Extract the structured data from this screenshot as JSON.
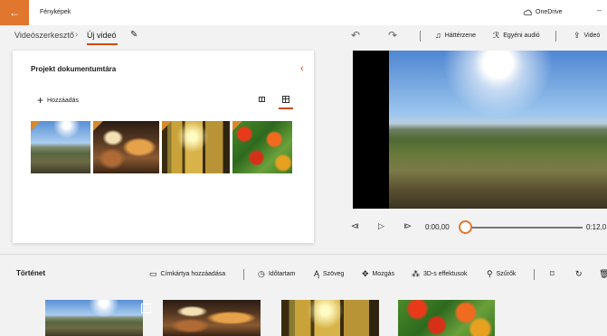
{
  "titlebar": {
    "back_icon": "back-arrow-icon",
    "app_title": "Fényképek",
    "onedrive_label": "OneDrive",
    "minimize_glyph": "–",
    "accent_color": "#e1762f"
  },
  "breadcrumb": {
    "root": "Videószerkesztő",
    "current": "Új videó"
  },
  "toolbar": {
    "background_music": "Háttérzene",
    "custom_audio": "Egyéni audió",
    "export": "Videó"
  },
  "library": {
    "title": "Projekt dokumentumtára",
    "add_label": "Hozzáadás",
    "thumbnails": [
      "landscape",
      "coffee",
      "autumn-forest",
      "autumn-leaves"
    ]
  },
  "player": {
    "current_time": "0:00,00",
    "end_time": "0:12,0",
    "progress": 0
  },
  "storyboard": {
    "title": "Történet",
    "add_title_card": "Címkártya hozzáadása",
    "duration": "Időtartam",
    "text": "Szöveg",
    "motion": "Mozgás",
    "effects_3d": "3D-s effektusok",
    "filters": "Szűrők",
    "clips": [
      "landscape",
      "coffee",
      "autumn-forest",
      "autumn-leaves"
    ]
  }
}
